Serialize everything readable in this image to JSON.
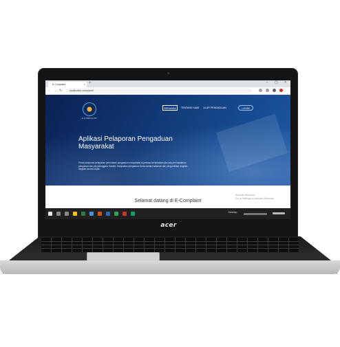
{
  "browser": {
    "tab_title": "E-Complaint",
    "tab_close": "×",
    "new_tab": "+",
    "window_controls": "–  ▢  ×",
    "url": "localhost/e-complaint/"
  },
  "site": {
    "nav": [
      {
        "label": "BERANDA"
      },
      {
        "label": "TENTANG KAMI"
      },
      {
        "label": "ALUR PENGADUAN"
      },
      {
        "label": "LOGIN"
      }
    ],
    "hero_title": "Aplikasi Pelaporan Pengaduan Masyarakat",
    "hero_description": "Portal pelaporan pelayanan permintaan pengaduan masyarakat di jaminan kerahasiaan jika ada permasalahan pelayanan dan penyelenggara Kawilat. Sampaikan pengaduan Anda melalui halaman dan pengambilan langkah-langkah secara cepat.",
    "welcome": "Selamat datang di E-Complaint"
  },
  "windows": {
    "activate_title": "Activate Windows",
    "activate_sub": "Go to Settings to activate Windows.",
    "tray_text": "Desktop"
  },
  "hardware": {
    "brand": "acer"
  },
  "colors": {
    "hero_dark": "#0b2153",
    "hero_light": "#1c5aa6",
    "taskbar": "#202020",
    "logo_accent": "#f6b23a"
  }
}
